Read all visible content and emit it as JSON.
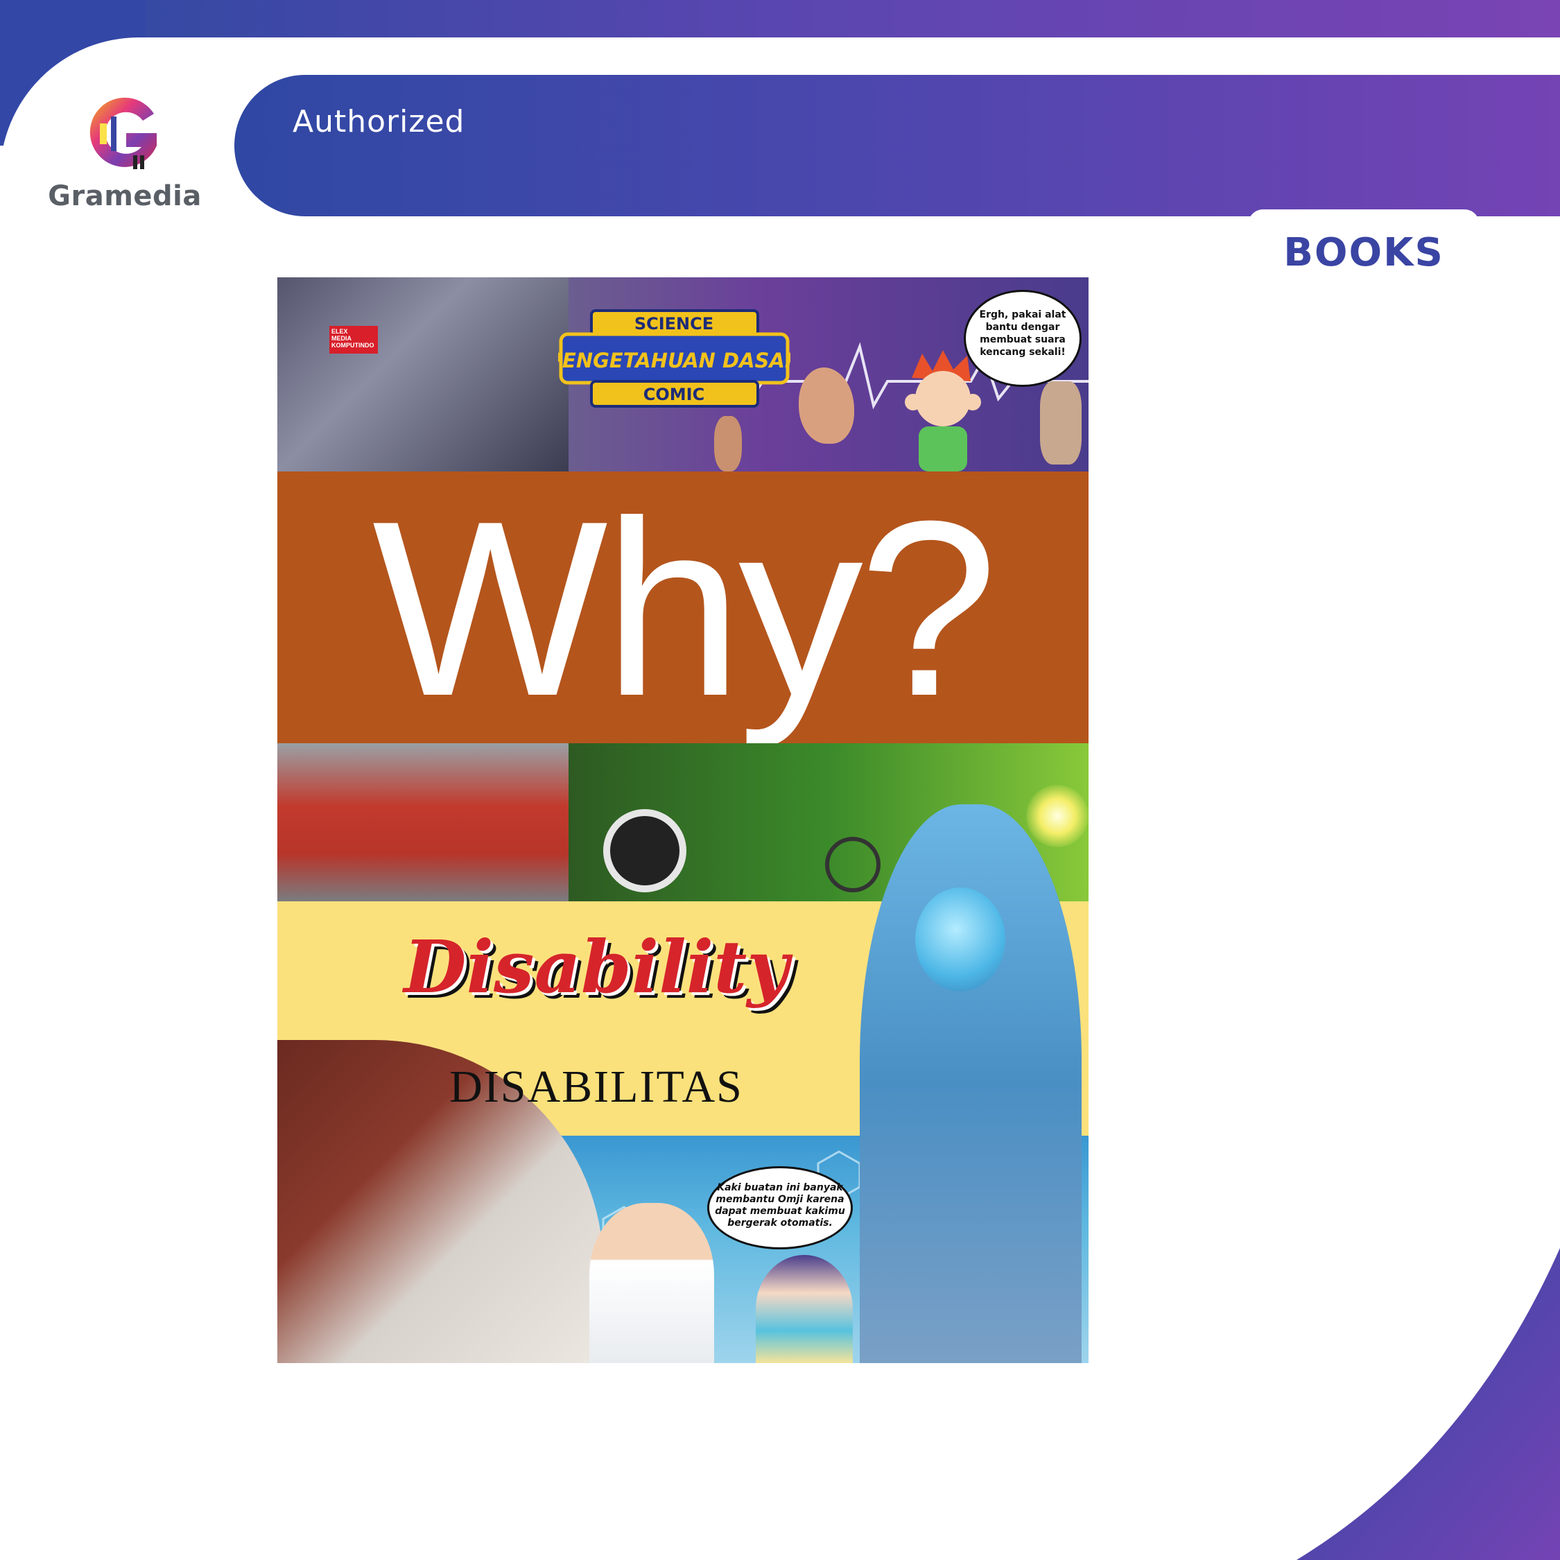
{
  "brand": {
    "name": "Gramedia",
    "logo_icon": "gramedia-g-logo-icon",
    "colors": {
      "primary": "#3a44a3",
      "gradient_start": "#2f48a3",
      "gradient_end": "#7443b4"
    }
  },
  "banner": {
    "label": "Authorized",
    "tab_label": "BOOKS"
  },
  "cover": {
    "badge_top": "SCIENCE",
    "badge_middle": "PENGETAHUAN DASAR",
    "badge_bottom": "COMIC",
    "publisher_lines": [
      "ELEX",
      "MEDIA",
      "KOMPUTINDO"
    ],
    "bubble_top_lines": [
      "Ergh, pakai alat",
      "bantu dengar",
      "membuat suara",
      "kencang sekali!"
    ],
    "series_title": "Why?",
    "title_en": "Disability",
    "title_id": "DISABILITAS",
    "bubble_bottom_lines": [
      "Kaki buatan ini banyak",
      "membantu Omji karena",
      "dapat membuat kakimu",
      "bergerak otomatis."
    ],
    "colors": {
      "why_band": "#b4551c",
      "yellow_band": "#fbe17c",
      "title_red": "#d6242b"
    }
  }
}
